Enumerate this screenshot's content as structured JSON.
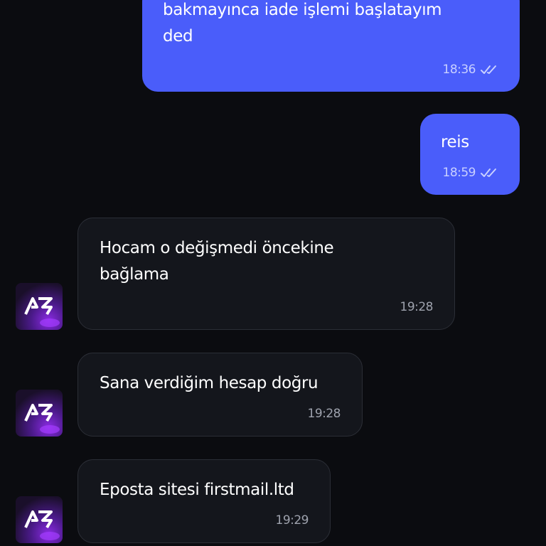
{
  "messages": [
    {
      "direction": "outgoing",
      "text": "bakmayınca iade işlemi başlatayım\nded",
      "time": "18:36",
      "status_icon": "double-check-icon"
    },
    {
      "direction": "outgoing",
      "text": "reis",
      "time": "18:59",
      "status_icon": "double-check-icon"
    },
    {
      "direction": "incoming",
      "text": "Hocam o değişmedi öncekine\nbağlama",
      "time": "19:28",
      "avatar_icon": "contact-avatar"
    },
    {
      "direction": "incoming",
      "text": "Sana verdiğim hesap doğru",
      "time": "19:28",
      "avatar_icon": "contact-avatar"
    },
    {
      "direction": "incoming",
      "text": "Eposta sitesi firstmail.ltd",
      "time": "19:29",
      "avatar_icon": "contact-avatar"
    }
  ],
  "colors": {
    "background": "#0b0c10",
    "outgoing_bubble": "#4a5dfa",
    "incoming_bubble": "#14161c"
  }
}
